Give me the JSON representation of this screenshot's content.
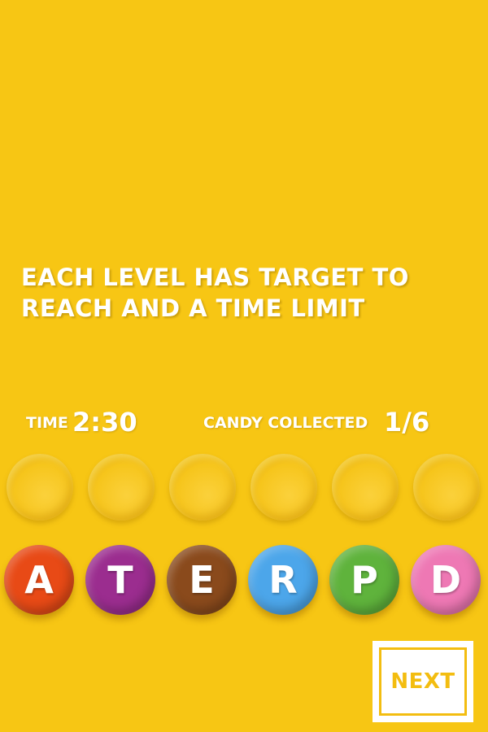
{
  "instructions": {
    "line1": "EACH LEVEL HAS TARGET TO",
    "line2": "REACH AND A TIME LIMIT"
  },
  "hud": {
    "time_label": "TIME",
    "time_value": "2:30",
    "candy_label": "CANDY COLLECTED",
    "candy_value": "1/6"
  },
  "slots_count": 6,
  "candies": [
    {
      "letter": "A",
      "color": "#e84a16"
    },
    {
      "letter": "T",
      "color": "#9b2d8f"
    },
    {
      "letter": "E",
      "color": "#8a4a1c"
    },
    {
      "letter": "R",
      "color": "#4ca6ea"
    },
    {
      "letter": "P",
      "color": "#5fb33c"
    },
    {
      "letter": "D",
      "color": "#ee78b4"
    }
  ],
  "next_button": {
    "label": "NEXT"
  },
  "colors": {
    "background": "#f7c614",
    "accent": "#f3bd10"
  }
}
